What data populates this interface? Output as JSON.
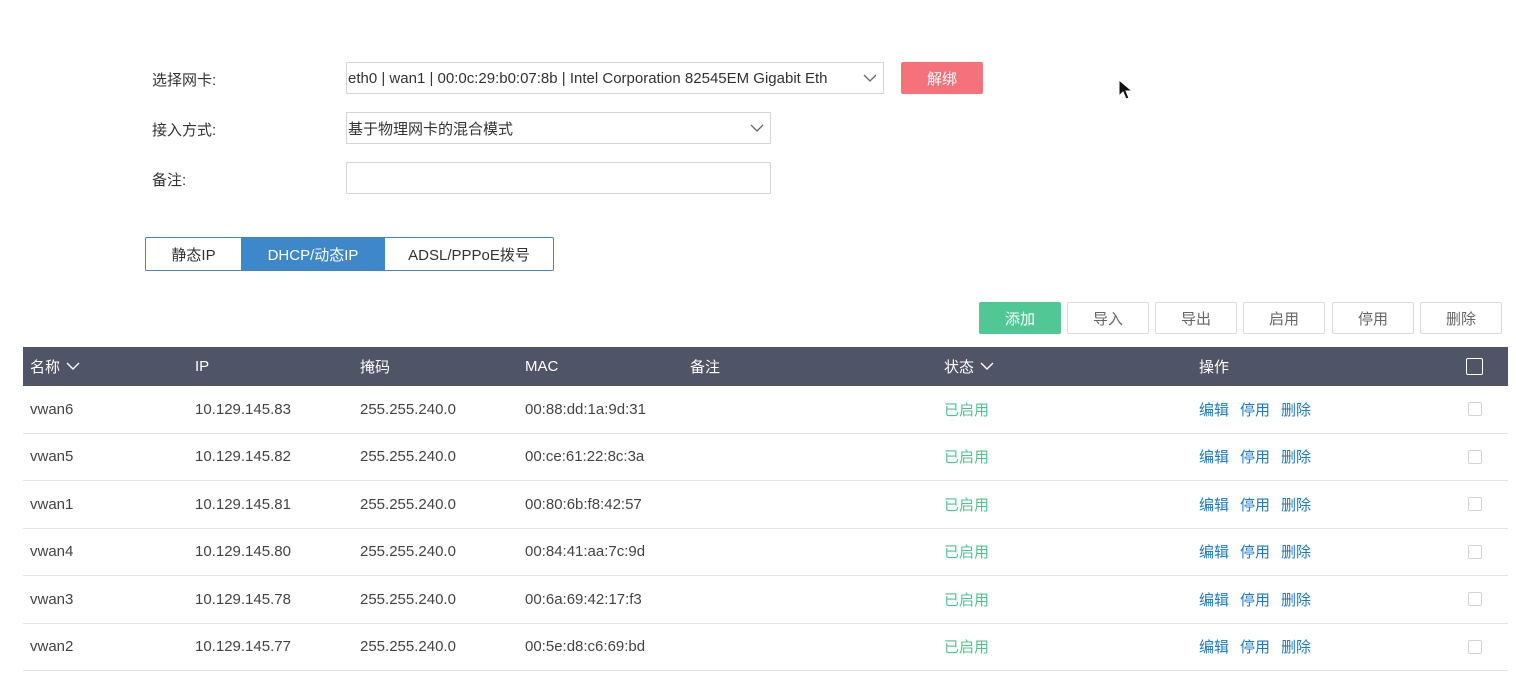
{
  "form": {
    "nic_label": "选择网卡:",
    "nic_value": "eth0 | wan1 | 00:0c:29:b0:07:8b | Intel Corporation 82545EM Gigabit Eth",
    "unbind_label": "解绑",
    "access_label": "接入方式:",
    "access_value": "基于物理网卡的混合模式",
    "remark_label": "备注:",
    "remark_value": ""
  },
  "tabs": [
    "静态IP",
    "DHCP/动态IP",
    "ADSL/PPPoE拨号"
  ],
  "active_tab": 1,
  "toolbar": {
    "add": "添加",
    "import": "导入",
    "export": "导出",
    "enable": "启用",
    "disable": "停用",
    "delete": "删除"
  },
  "table": {
    "headers": {
      "name": "名称",
      "ip": "IP",
      "mask": "掩码",
      "mac": "MAC",
      "remark": "备注",
      "status": "状态",
      "ops": "操作"
    },
    "op_labels": {
      "edit": "编辑",
      "disable": "停用",
      "delete": "删除"
    },
    "rows": [
      {
        "name": "vwan6",
        "ip": "10.129.145.83",
        "mask": "255.255.240.0",
        "mac": "00:88:dd:1a:9d:31",
        "remark": "",
        "status": "已启用"
      },
      {
        "name": "vwan5",
        "ip": "10.129.145.82",
        "mask": "255.255.240.0",
        "mac": "00:ce:61:22:8c:3a",
        "remark": "",
        "status": "已启用"
      },
      {
        "name": "vwan1",
        "ip": "10.129.145.81",
        "mask": "255.255.240.0",
        "mac": "00:80:6b:f8:42:57",
        "remark": "",
        "status": "已启用"
      },
      {
        "name": "vwan4",
        "ip": "10.129.145.80",
        "mask": "255.255.240.0",
        "mac": "00:84:41:aa:7c:9d",
        "remark": "",
        "status": "已启用"
      },
      {
        "name": "vwan3",
        "ip": "10.129.145.78",
        "mask": "255.255.240.0",
        "mac": "00:6a:69:42:17:f3",
        "remark": "",
        "status": "已启用"
      },
      {
        "name": "vwan2",
        "ip": "10.129.145.77",
        "mask": "255.255.240.0",
        "mac": "00:5e:d8:c6:69:bd",
        "remark": "",
        "status": "已启用"
      }
    ]
  },
  "colors": {
    "accent_blue": "#3e87c8",
    "add_green": "#52c796",
    "unbind_red": "#f6727a",
    "header_bg": "#4f5467",
    "status_green": "#4fc38f",
    "link_blue": "#1b79c6"
  }
}
